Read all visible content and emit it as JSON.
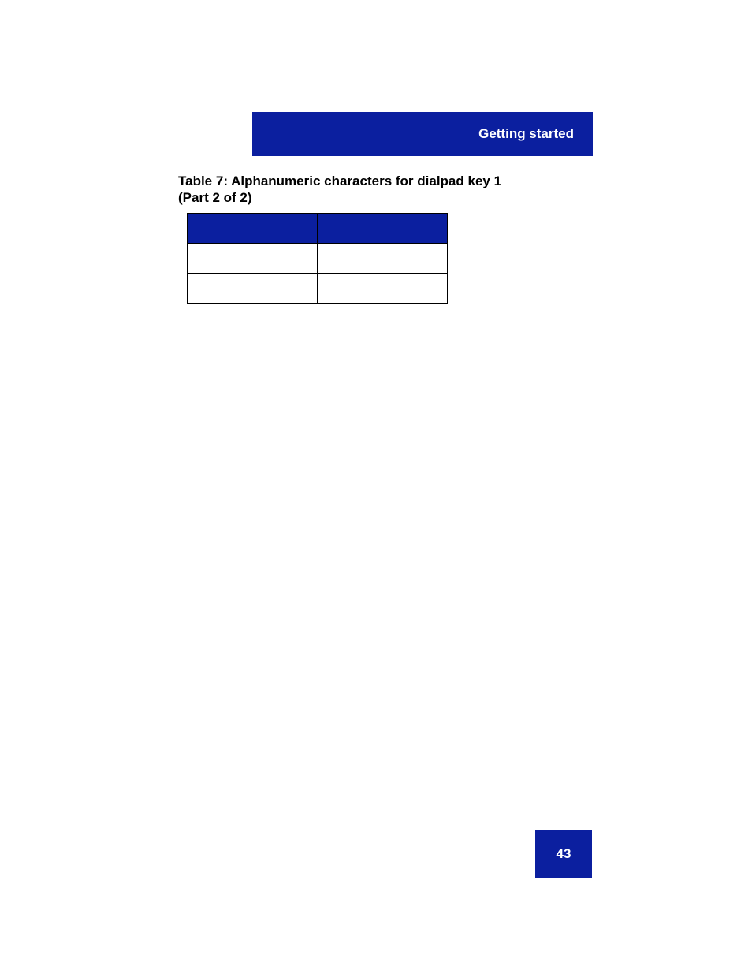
{
  "header": {
    "section_title": "Getting started"
  },
  "table": {
    "caption_line1": "Table 7: Alphanumeric characters for dialpad key 1",
    "caption_line2": "(Part 2 of 2)",
    "headers": [
      "",
      ""
    ],
    "rows": [
      [
        "",
        ""
      ],
      [
        "",
        ""
      ]
    ]
  },
  "footer": {
    "page_number": "43"
  }
}
